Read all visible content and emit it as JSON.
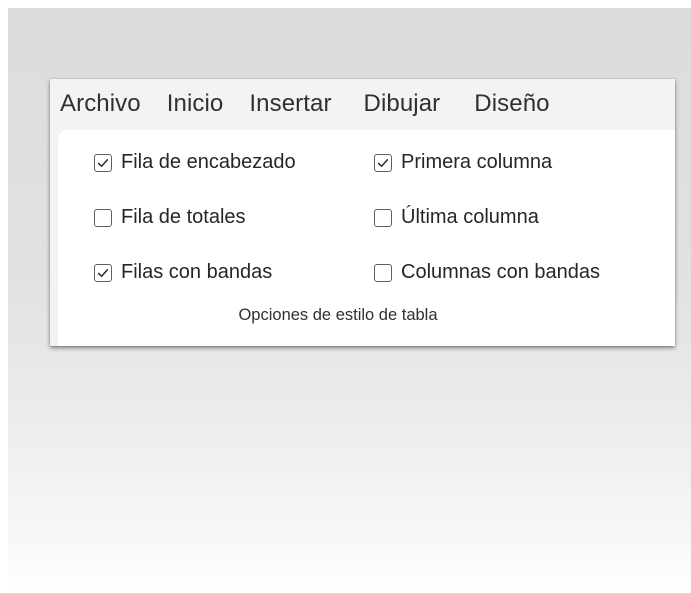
{
  "menu": {
    "items": [
      {
        "label": "Archivo"
      },
      {
        "label": "Inicio"
      },
      {
        "label": "Insertar"
      },
      {
        "label": "Dibujar"
      },
      {
        "label": "Diseño"
      }
    ]
  },
  "table_style_options": {
    "caption": "Opciones de estilo de tabla",
    "options": [
      {
        "label": "Fila de encabezado",
        "checked": true
      },
      {
        "label": "Primera columna",
        "checked": true
      },
      {
        "label": "Fila de totales",
        "checked": false
      },
      {
        "label": "Última columna",
        "checked": false
      },
      {
        "label": "Filas con bandas",
        "checked": true
      },
      {
        "label": "Columnas con bandas",
        "checked": false
      }
    ]
  },
  "colors": {
    "background_top": "#dcdcdc",
    "background_bottom": "#ffffff",
    "ribbon_bg": "#f3f3f3",
    "group_bg": "#ffffff",
    "text": "#262626",
    "checkbox_border": "#5f5f5f"
  },
  "icons": {
    "checked": "checkmark-icon"
  }
}
